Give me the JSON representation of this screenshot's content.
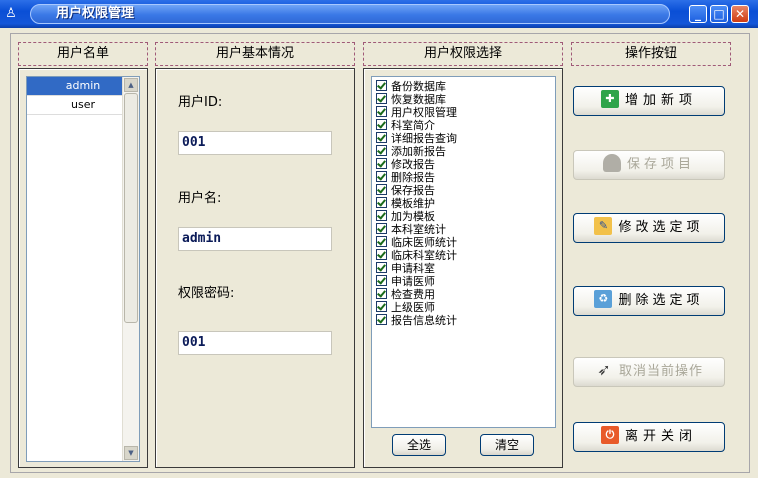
{
  "window": {
    "title": "用户权限管理"
  },
  "headers": {
    "user_list": "用户名单",
    "user_info": "用户基本情况",
    "permissions": "用户权限选择",
    "actions": "操作按钮"
  },
  "users": [
    {
      "name": "admin",
      "selected": true
    },
    {
      "name": "user",
      "selected": false
    }
  ],
  "user_info": {
    "user_id_label": "用户ID:",
    "user_id_value": "001",
    "user_name_label": "用户名:",
    "user_name_value": "admin",
    "password_label": "权限密码:",
    "password_value": "001"
  },
  "permissions": [
    "备份数据库",
    "恢复数据库",
    "用户权限管理",
    "科室简介",
    "详细报告查询",
    "添加新报告",
    "修改报告",
    "删除报告",
    "保存报告",
    "模板维护",
    "加为模板",
    "本科室统计",
    "临床医师统计",
    "临床科室统计",
    "申请科室",
    "申请医师",
    "检查费用",
    "上级医师",
    "报告信息统计"
  ],
  "perm_buttons": {
    "select_all": "全选",
    "clear": "清空"
  },
  "actions": {
    "add": "增加新项",
    "save": "保存项目",
    "edit": "修改选定项",
    "delete": "删除选定项",
    "cancel": "取消当前操作",
    "close": "离开关闭"
  },
  "icons": {
    "add": "add-icon",
    "save": "save-icon",
    "edit": "edit-icon",
    "delete": "delete-icon",
    "cancel": "cancel-icon",
    "close": "power-icon"
  },
  "colors": {
    "title_bar": "#0a4fd6",
    "selection": "#316ac5",
    "face": "#ece9d8",
    "disabled_text": "#a9a799"
  }
}
